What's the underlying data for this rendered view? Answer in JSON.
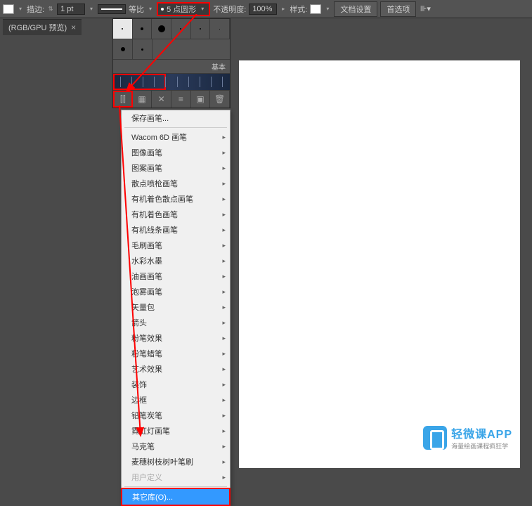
{
  "toolbar": {
    "stroke_label": "描边:",
    "stroke_weight": "1 pt",
    "profile": "等比",
    "brush_name": "5 点圆形",
    "opacity_label": "不透明度:",
    "opacity_value": "100%",
    "style_label": "样式:",
    "doc_setup": "文档设置",
    "prefs": "首选项"
  },
  "tab": {
    "title": "(RGB/GPU 预览)",
    "close": "×"
  },
  "brush_panel": {
    "basic_label": "基本"
  },
  "menu": {
    "items": [
      {
        "label": "保存画笔...",
        "sub": false
      },
      {
        "sep": true
      },
      {
        "label": "Wacom 6D 画笔",
        "sub": true
      },
      {
        "label": "图像画笔",
        "sub": true
      },
      {
        "label": "图案画笔",
        "sub": true
      },
      {
        "label": "散点喷枪画笔",
        "sub": true
      },
      {
        "label": "有机着色散点画笔",
        "sub": true
      },
      {
        "label": "有机着色画笔",
        "sub": true
      },
      {
        "label": "有机线条画笔",
        "sub": true
      },
      {
        "label": "毛刷画笔",
        "sub": true
      },
      {
        "label": "水彩水墨",
        "sub": true
      },
      {
        "label": "油画画笔",
        "sub": true
      },
      {
        "label": "泡雾画笔",
        "sub": true
      },
      {
        "label": "矢量包",
        "sub": true
      },
      {
        "label": "箭头",
        "sub": true
      },
      {
        "label": "粉笔效果",
        "sub": true
      },
      {
        "label": "粉笔蜡笔",
        "sub": true
      },
      {
        "label": "艺术效果",
        "sub": true
      },
      {
        "label": "装饰",
        "sub": true
      },
      {
        "label": "边框",
        "sub": true
      },
      {
        "label": "铅笔炭笔",
        "sub": true
      },
      {
        "label": "霓虹灯画笔",
        "sub": true
      },
      {
        "label": "马克笔",
        "sub": true
      },
      {
        "label": "麦穗树枝树叶笔刷",
        "sub": true
      },
      {
        "label": "用户定义",
        "sub": true,
        "disabled": true
      },
      {
        "sep": true
      },
      {
        "label": "其它库(O)...",
        "sub": false,
        "highlighted": true
      }
    ]
  },
  "watermark": {
    "title": "轻微课APP",
    "subtitle": "海量绘画课程疯狂学"
  }
}
